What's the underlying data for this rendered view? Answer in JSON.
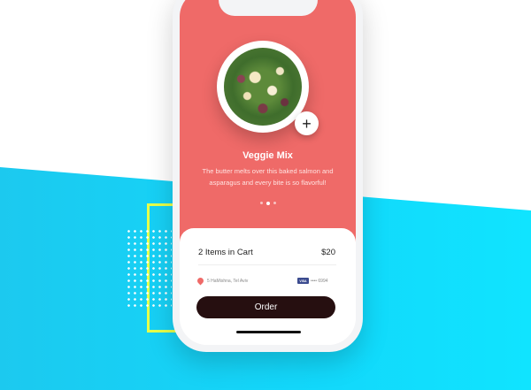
{
  "product": {
    "title": "Veggie Mix",
    "description": "The butter melts over this baked salmon and asparagus and every bite is so flavorful!",
    "add_label": "+"
  },
  "pager": {
    "count": 3,
    "active": 1
  },
  "cart": {
    "items_label": "2 Items in Cart",
    "total": "$20",
    "address": "5 HaMishna, Tel Aviv",
    "card_brand": "VISA",
    "card_number": "•••• 6994",
    "order_label": "Order"
  },
  "colors": {
    "hero": "#ef6a68",
    "order_button": "#260f10",
    "background_accent": "#12d8fb",
    "deco_outline": "#e6ff4a"
  },
  "icons": {
    "add": "plus-icon",
    "location": "map-pin-icon",
    "card": "visa-card-icon"
  }
}
